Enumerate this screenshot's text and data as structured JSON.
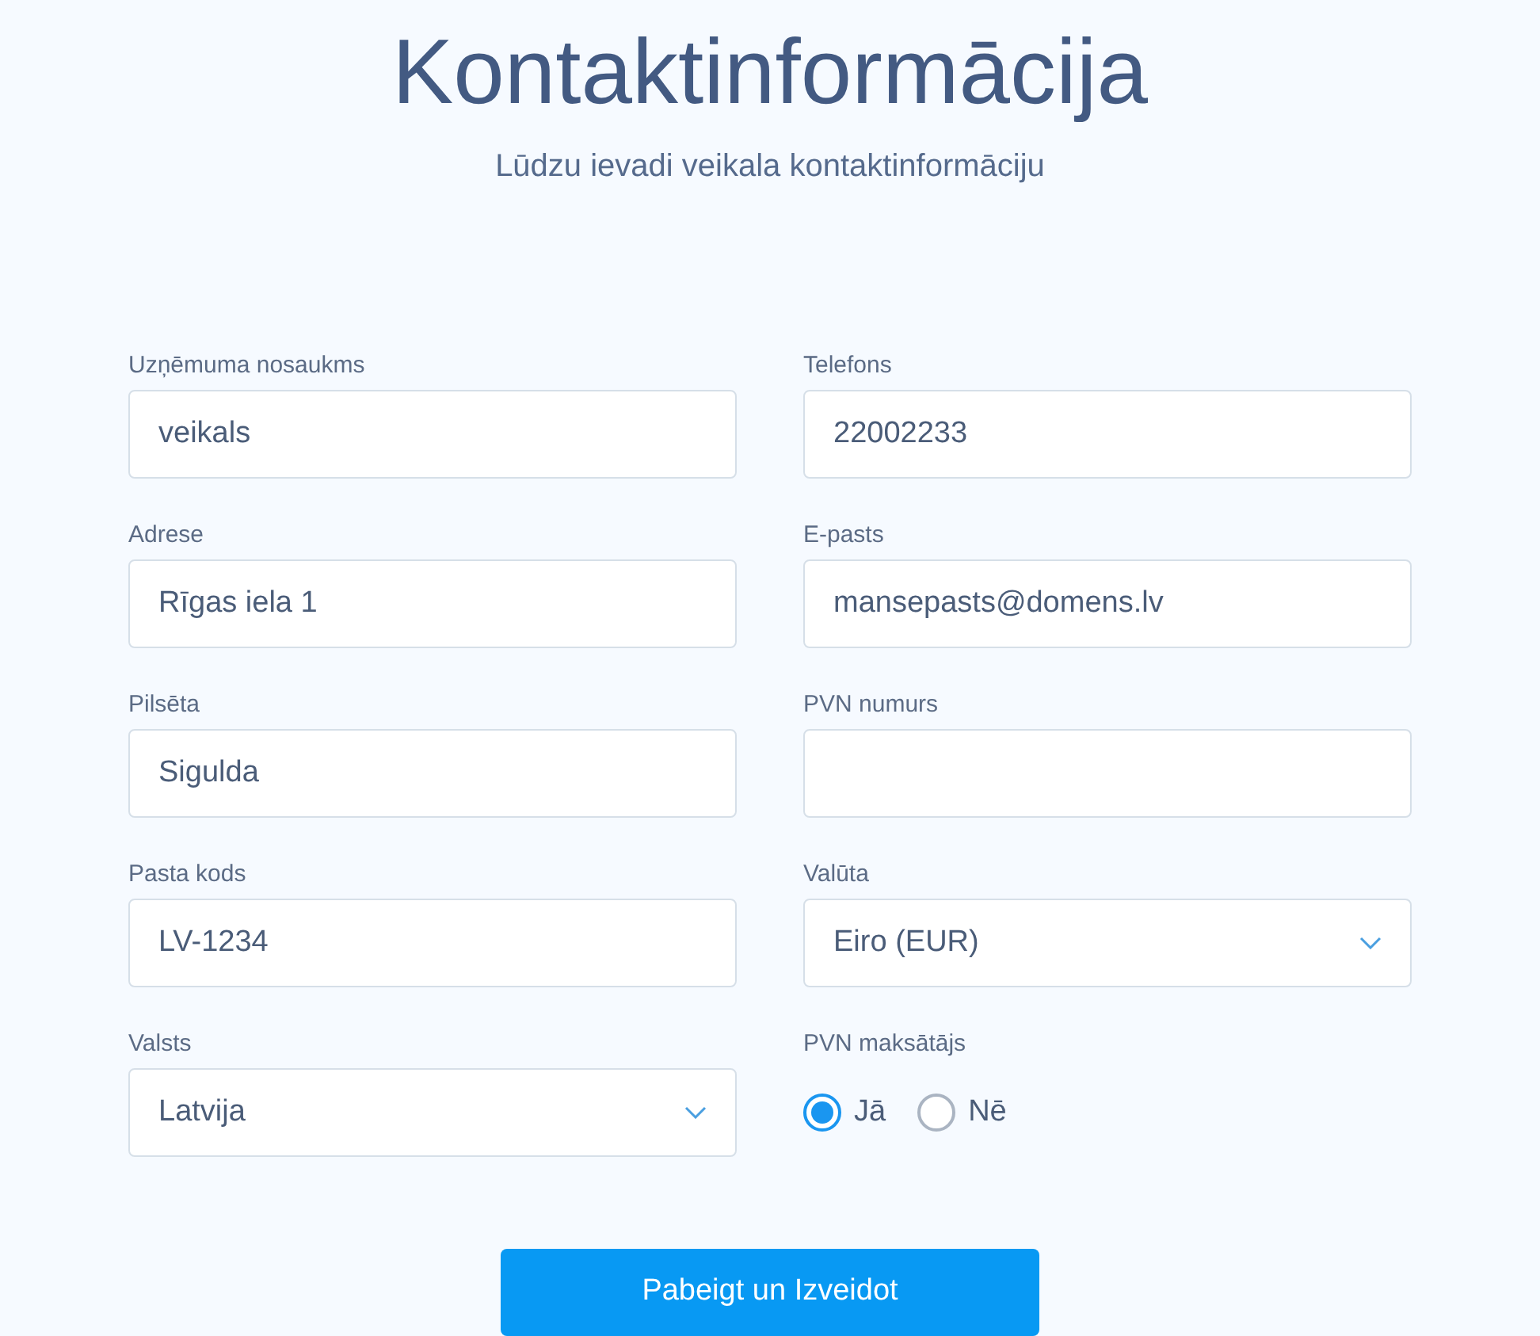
{
  "title": "Kontaktinformācija",
  "subtitle": "Lūdzu ievadi veikala kontaktinformāciju",
  "fields": [
    {
      "kind": "text",
      "label": "Uzņēmuma nosaukms",
      "value": "veikals"
    },
    {
      "kind": "text",
      "label": "Telefons",
      "value": "22002233"
    },
    {
      "kind": "text",
      "label": "Adrese",
      "value": "Rīgas iela 1"
    },
    {
      "kind": "text",
      "label": "E-pasts",
      "value": "mansepasts@domens.lv"
    },
    {
      "kind": "text",
      "label": "Pilsēta",
      "value": "Sigulda"
    },
    {
      "kind": "text",
      "label": "PVN numurs"
    },
    {
      "kind": "text",
      "label": "Pasta kods",
      "value": "LV-1234"
    },
    {
      "kind": "select",
      "label": "Valūta",
      "value": "Eiro (EUR)"
    },
    {
      "kind": "select",
      "label": "Valsts",
      "value": "Latvija"
    },
    {
      "kind": "radio",
      "label": "PVN maksātājs",
      "options": [
        {
          "label": "Jā",
          "selected": true
        },
        {
          "label": "Nē",
          "selected": false
        }
      ]
    }
  ],
  "submit": "Pabeigt un Izveidot"
}
